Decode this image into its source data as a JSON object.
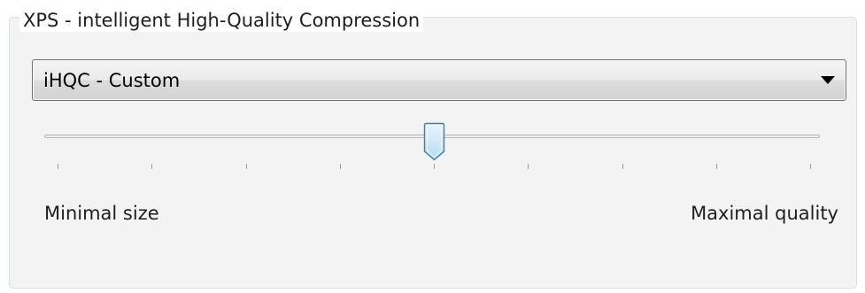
{
  "group": {
    "title": "XPS - intelligent High-Quality Compression"
  },
  "compression_preset": {
    "selected": "iHQC - Custom"
  },
  "quality_slider": {
    "min_label": "Minimal size",
    "max_label": "Maximal quality",
    "tick_count": 9,
    "value_fraction": 0.5
  },
  "colors": {
    "group_background": "#f3f3f3",
    "group_border": "#d5dfe5",
    "thumb_fill": "#cfe8f8",
    "thumb_border": "#3c7fb1"
  },
  "icons": {
    "combo_arrow": "triangle-down-icon",
    "slider_thumb": "slider-thumb-icon"
  }
}
